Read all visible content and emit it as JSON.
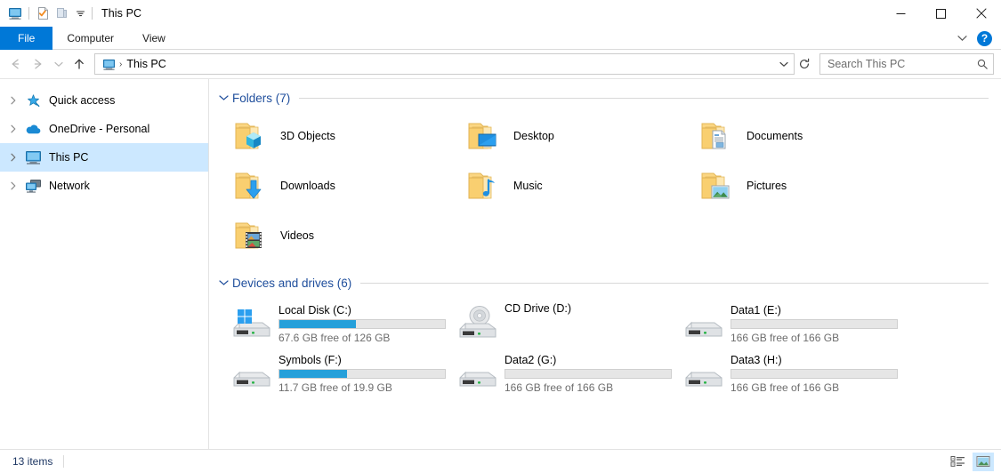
{
  "window": {
    "title": "This PC",
    "quick_access_toolbar": [
      {
        "name": "this-pc-icon",
        "label": "This PC"
      },
      {
        "name": "properties-icon",
        "label": "Properties"
      },
      {
        "name": "new-folder-icon",
        "label": "New folder"
      },
      {
        "name": "customize-chevron-icon",
        "label": "Customize Quick Access Toolbar"
      }
    ],
    "controls": {
      "minimize": "Minimize",
      "maximize": "Maximize",
      "close": "Close"
    }
  },
  "ribbon": {
    "tabs": [
      {
        "label": "File",
        "active": true
      },
      {
        "label": "Computer",
        "active": false
      },
      {
        "label": "View",
        "active": false
      }
    ],
    "expand_label": "Expand the Ribbon",
    "help_label": "?"
  },
  "address": {
    "back_label": "Back",
    "forward_label": "Forward",
    "recent_label": "Recent locations",
    "up_label": "Up",
    "breadcrumb_icon": "this-pc-icon",
    "breadcrumb": "This PC",
    "separator": "›",
    "dropdown_label": "Previous locations",
    "refresh_label": "Refresh"
  },
  "search": {
    "placeholder": "Search This PC",
    "icon": "search-icon"
  },
  "navpane": {
    "items": [
      {
        "label": "Quick access",
        "icon": "star-icon",
        "selected": false,
        "expandable": true
      },
      {
        "label": "OneDrive - Personal",
        "icon": "cloud-icon",
        "selected": false,
        "expandable": true
      },
      {
        "label": "This PC",
        "icon": "this-pc-icon",
        "selected": true,
        "expandable": true
      },
      {
        "label": "Network",
        "icon": "network-icon",
        "selected": false,
        "expandable": true
      }
    ]
  },
  "content": {
    "groups": [
      {
        "title": "Folders (7)",
        "expanded": true,
        "items": [
          {
            "name": "3D Objects",
            "icon": "folder-3d-objects-icon"
          },
          {
            "name": "Desktop",
            "icon": "folder-desktop-icon"
          },
          {
            "name": "Documents",
            "icon": "folder-documents-icon"
          },
          {
            "name": "Downloads",
            "icon": "folder-downloads-icon"
          },
          {
            "name": "Music",
            "icon": "folder-music-icon"
          },
          {
            "name": "Pictures",
            "icon": "folder-pictures-icon"
          },
          {
            "name": "Videos",
            "icon": "folder-videos-icon"
          }
        ]
      },
      {
        "title": "Devices and drives (6)",
        "expanded": true,
        "drives": [
          {
            "name": "Local Disk (C:)",
            "icon": "windows-drive-icon",
            "has_bar": true,
            "used_percent": 46,
            "free_text": "67.6 GB free of 126 GB"
          },
          {
            "name": "CD Drive (D:)",
            "icon": "cd-drive-icon",
            "has_bar": false,
            "used_percent": 0,
            "free_text": ""
          },
          {
            "name": "Data1 (E:)",
            "icon": "hard-drive-icon",
            "has_bar": true,
            "used_percent": 0,
            "free_text": "166 GB free of 166 GB"
          },
          {
            "name": "Symbols (F:)",
            "icon": "hard-drive-icon",
            "has_bar": true,
            "used_percent": 41,
            "free_text": "11.7 GB free of 19.9 GB"
          },
          {
            "name": "Data2 (G:)",
            "icon": "hard-drive-icon",
            "has_bar": true,
            "used_percent": 0,
            "free_text": "166 GB free of 166 GB"
          },
          {
            "name": "Data3 (H:)",
            "icon": "hard-drive-icon",
            "has_bar": true,
            "used_percent": 0,
            "free_text": "166 GB free of 166 GB"
          }
        ]
      }
    ]
  },
  "statusbar": {
    "item_count": "13 items",
    "views": [
      {
        "name": "details-view-button",
        "label": "Details view",
        "active": false
      },
      {
        "name": "large-icons-view-button",
        "label": "Large icons view",
        "active": true
      }
    ]
  },
  "colors": {
    "accent": "#0078d7",
    "selection": "#cce8ff",
    "group_header": "#1f4e9c",
    "bar_fill": "#26a0da",
    "status_text": "#1f3864"
  }
}
